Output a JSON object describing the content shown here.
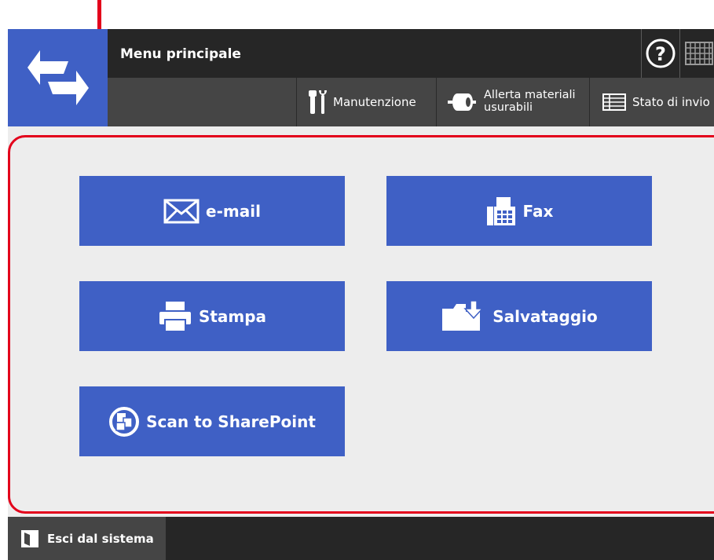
{
  "header": {
    "title": "Menu principale",
    "logo_icon": "double-arrow-icon",
    "help_icon": "help-circle-icon",
    "keyboard_icon": "keyboard-icon"
  },
  "toolbar": {
    "maintenance_label": "Manutenzione",
    "maintenance_icon": "tools-icon",
    "alert_label_line1": "Allerta materiali",
    "alert_label_line2": "usurabili",
    "alert_icon": "roller-icon",
    "send_status_label": "Stato di invio",
    "send_status_icon": "list-icon"
  },
  "functions": {
    "email_label": "e-mail",
    "email_icon": "envelope-icon",
    "fax_label": "Fax",
    "fax_icon": "fax-icon",
    "print_label": "Stampa",
    "print_icon": "printer-icon",
    "save_label": "Salvataggio",
    "save_icon": "folder-download-icon",
    "sharepoint_label": "Scan to SharePoint",
    "sharepoint_icon": "sharepoint-icon"
  },
  "footer": {
    "logout_label": "Esci dal sistema",
    "logout_icon": "door-icon"
  },
  "colors": {
    "accent": "#3f60c5",
    "highlight": "#e3001b",
    "dark": "#262626",
    "panel": "#ededed"
  }
}
